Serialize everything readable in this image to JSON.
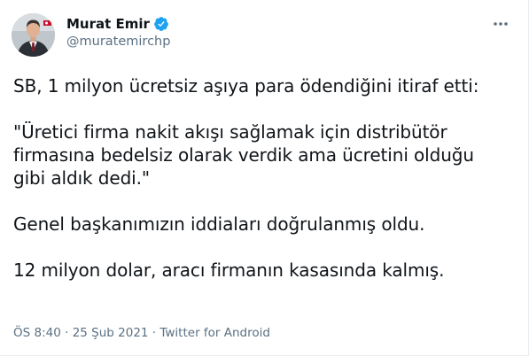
{
  "author": {
    "display_name": "Murat Emir",
    "handle": "@muratemirchp",
    "verified": true,
    "avatar_icon": "profile-photo",
    "verified_color": "#1da1f2"
  },
  "menu_icon": "more-horizontal-icon",
  "tweet": {
    "paragraphs": [
      "SB, 1 milyon ücretsiz aşıya para ödendiğini itiraf etti:",
      "\"Üretici firma nakit akışı sağlamak için distribütör firmasına bedelsiz olarak verdik ama ücretini olduğu gibi aldık dedi.\"",
      "Genel başkanımızın iddiaları doğrulanmış oldu.",
      "12 milyon dolar, aracı firmanın kasasında kalmış."
    ]
  },
  "meta": {
    "time": "ÖS 8:40",
    "separator": " · ",
    "date": "25 Şub 2021",
    "source": "Twitter for Android"
  },
  "colors": {
    "text": "#0f1419",
    "secondary": "#5b7083",
    "border": "#e6ecf0"
  }
}
